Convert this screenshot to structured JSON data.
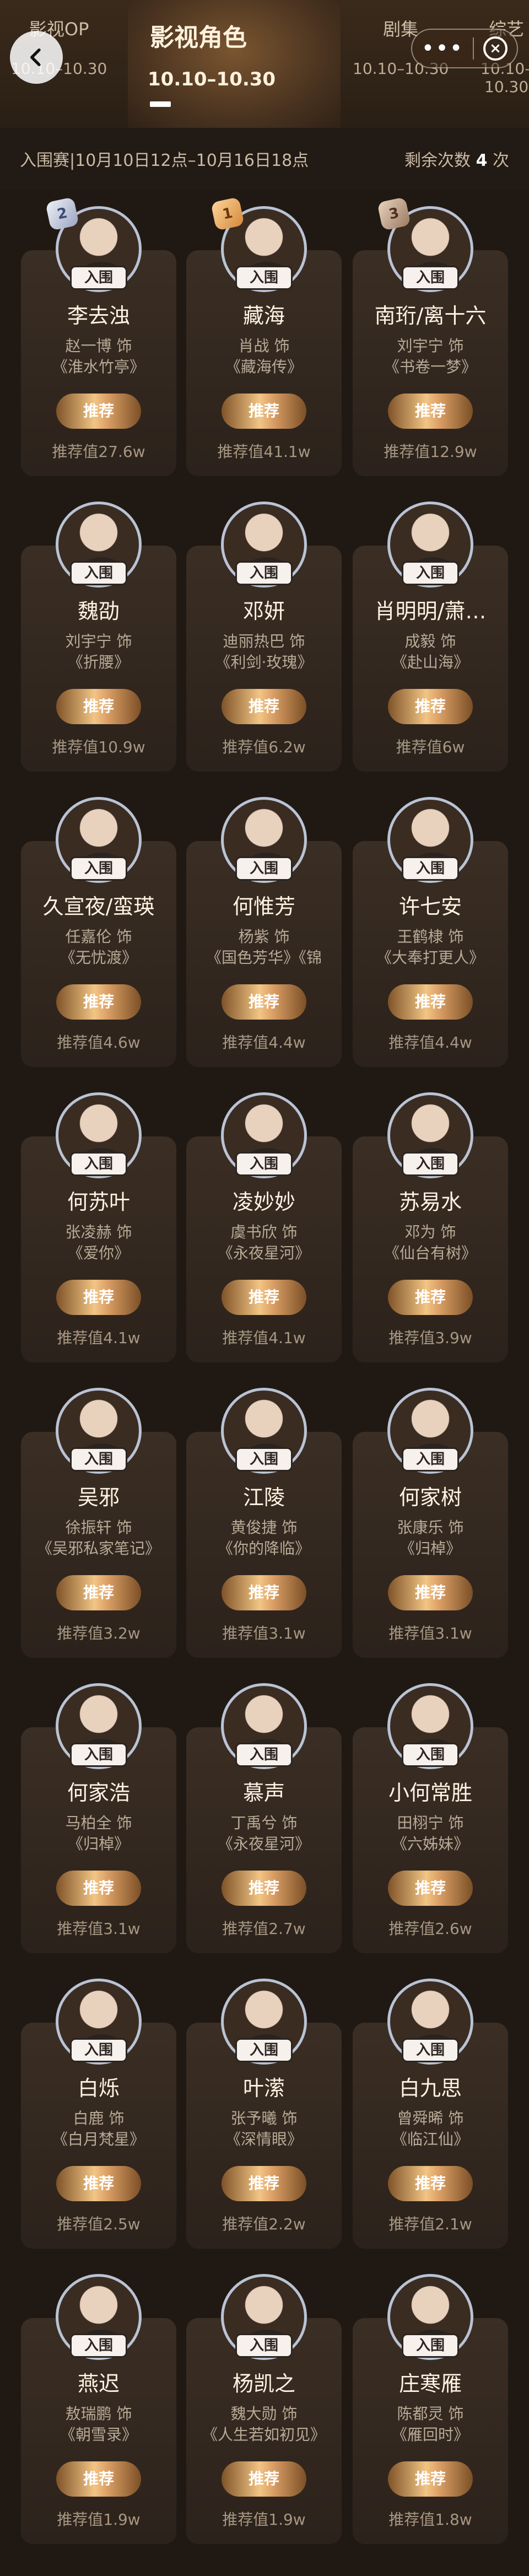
{
  "header": {
    "tabs": [
      {
        "name": "影视OP",
        "date": "10.10–10.30"
      },
      {
        "name": "影视角色",
        "date": "10.10–10.30"
      },
      {
        "name": "剧集",
        "date": "10.10–10.30"
      },
      {
        "name": "综艺",
        "date": "10.10–10.30"
      }
    ],
    "more_label": "•••",
    "close_label": "×"
  },
  "info": {
    "period": "入围赛|10月10日12点–10月16日18点",
    "remain_label": "剩余次数",
    "remain_count": "4",
    "remain_unit": "次"
  },
  "labels": {
    "badge": "入围",
    "recommend": "推荐"
  },
  "rank_icons": [
    "2",
    "1",
    "3"
  ],
  "cards": [
    {
      "name": "李去浊",
      "actor": "赵一博 饰",
      "work": "《淮水竹亭》",
      "value": "推荐值27.6w"
    },
    {
      "name": "藏海",
      "actor": "肖战 饰",
      "work": "《藏海传》",
      "value": "推荐值41.1w"
    },
    {
      "name": "南珩/离十六",
      "actor": "刘宇宁 饰",
      "work": "《书卷一梦》",
      "value": "推荐值12.9w"
    },
    {
      "name": "魏劭",
      "actor": "刘宇宁 饰",
      "work": "《折腰》",
      "value": "推荐值10.9w"
    },
    {
      "name": "邓妍",
      "actor": "迪丽热巴 饰",
      "work": "《利剑·玫瑰》",
      "value": "推荐值6.2w"
    },
    {
      "name": "肖明明/萧…",
      "actor": "成毅 饰",
      "work": "《赴山海》",
      "value": "推荐值6w"
    },
    {
      "name": "久宣夜/蛮瑛",
      "actor": "任嘉伦 饰",
      "work": "《无忧渡》",
      "value": "推荐值4.6w"
    },
    {
      "name": "何惟芳",
      "actor": "杨紫 饰",
      "work": "《国色芳华》《锦",
      "value": "推荐值4.4w"
    },
    {
      "name": "许七安",
      "actor": "王鹤棣 饰",
      "work": "《大奉打更人》",
      "value": "推荐值4.4w"
    },
    {
      "name": "何苏叶",
      "actor": "张凌赫 饰",
      "work": "《爱你》",
      "value": "推荐值4.1w"
    },
    {
      "name": "凌妙妙",
      "actor": "虞书欣 饰",
      "work": "《永夜星河》",
      "value": "推荐值4.1w"
    },
    {
      "name": "苏易水",
      "actor": "邓为 饰",
      "work": "《仙台有树》",
      "value": "推荐值3.9w"
    },
    {
      "name": "吴邪",
      "actor": "徐振轩 饰",
      "work": "《吴邪私家笔记》",
      "value": "推荐值3.2w"
    },
    {
      "name": "江陵",
      "actor": "黄俊捷 饰",
      "work": "《你的降临》",
      "value": "推荐值3.1w"
    },
    {
      "name": "何家树",
      "actor": "张康乐 饰",
      "work": "《归棹》",
      "value": "推荐值3.1w"
    },
    {
      "name": "何家浩",
      "actor": "马柏全 饰",
      "work": "《归棹》",
      "value": "推荐值3.1w"
    },
    {
      "name": "慕声",
      "actor": "丁禹兮 饰",
      "work": "《永夜星河》",
      "value": "推荐值2.7w"
    },
    {
      "name": "小何常胜",
      "actor": "田栩宁 饰",
      "work": "《六姊妹》",
      "value": "推荐值2.6w"
    },
    {
      "name": "白烁",
      "actor": "白鹿 饰",
      "work": "《白月梵星》",
      "value": "推荐值2.5w"
    },
    {
      "name": "叶潆",
      "actor": "张予曦 饰",
      "work": "《深情眼》",
      "value": "推荐值2.2w"
    },
    {
      "name": "白九思",
      "actor": "曾舜晞 饰",
      "work": "《临江仙》",
      "value": "推荐值2.1w"
    },
    {
      "name": "燕迟",
      "actor": "敖瑞鹏 饰",
      "work": "《朝雪录》",
      "value": "推荐值1.9w"
    },
    {
      "name": "杨凯之",
      "actor": "魏大勋 饰",
      "work": "《人生若如初见》",
      "value": "推荐值1.9w"
    },
    {
      "name": "庄寒雁",
      "actor": "陈都灵 饰",
      "work": "《雁回时》",
      "value": "推荐值1.8w"
    }
  ]
}
